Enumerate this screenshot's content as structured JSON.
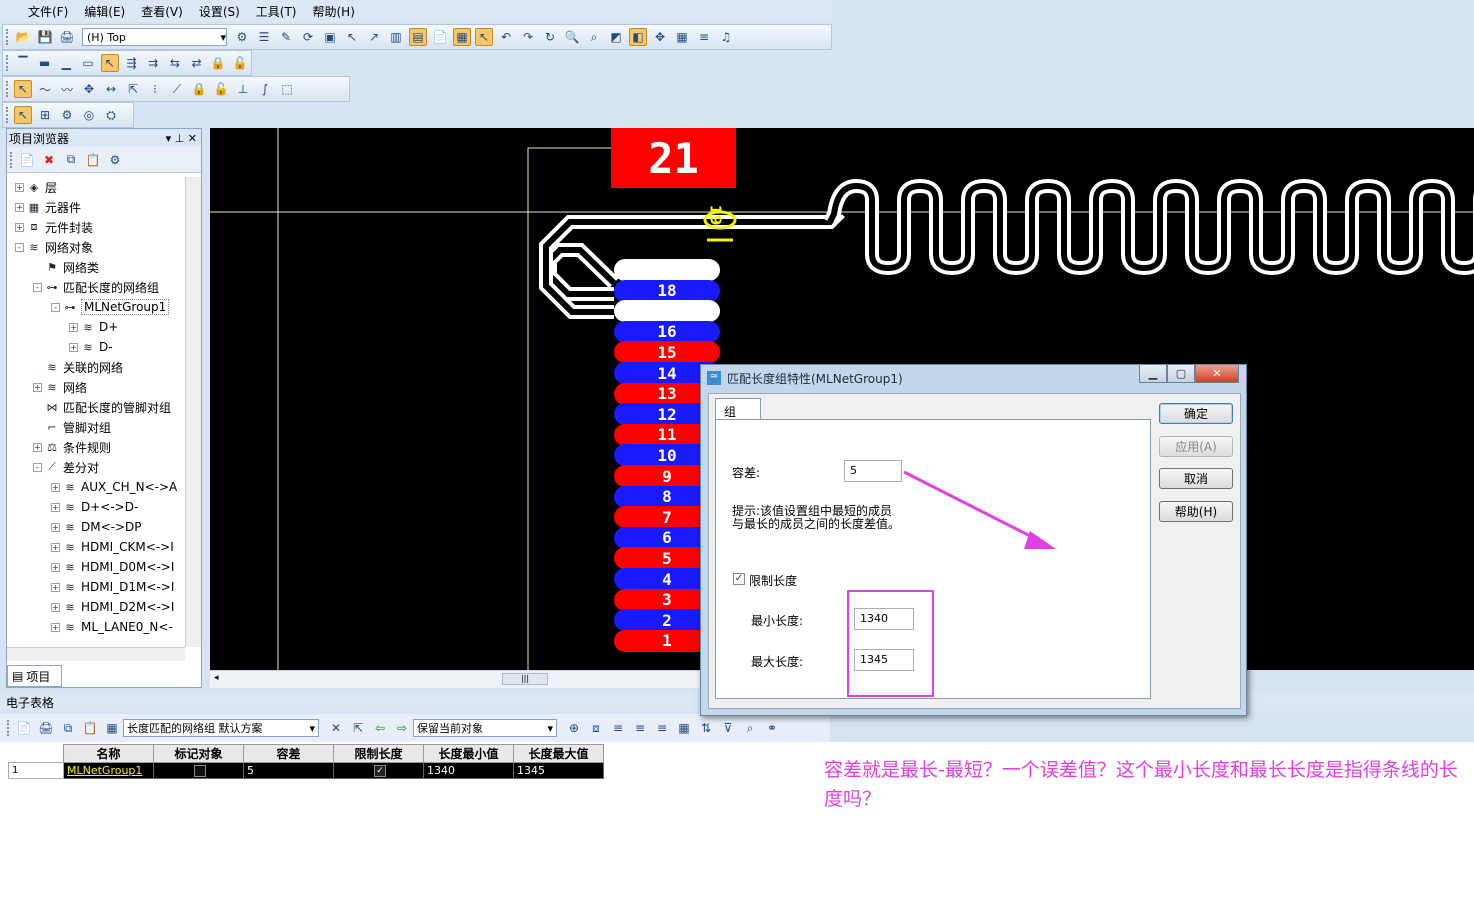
{
  "menu": [
    "文件(F)",
    "编辑(E)",
    "查看(V)",
    "设置(S)",
    "工具(T)",
    "帮助(H)"
  ],
  "toolbar": {
    "layer_value": "(H) Top"
  },
  "project_browser": {
    "title": "项目浏览器",
    "tab_label": "项目",
    "tree": [
      {
        "label": "层",
        "level": 0,
        "exp": "+",
        "icon": "layers-icon"
      },
      {
        "label": "元器件",
        "level": 0,
        "exp": "+",
        "icon": "component-icon"
      },
      {
        "label": "元件封装",
        "level": 0,
        "exp": "+",
        "icon": "footprint-icon"
      },
      {
        "label": "网络对象",
        "level": 0,
        "exp": "-",
        "icon": "net-objects-icon"
      },
      {
        "label": "网络类",
        "level": 1,
        "exp": "",
        "icon": "net-class-icon"
      },
      {
        "label": "匹配长度的网络组",
        "level": 1,
        "exp": "-",
        "icon": "matched-group-icon"
      },
      {
        "label": "MLNetGroup1",
        "level": 2,
        "exp": "-",
        "icon": "matched-group-icon"
      },
      {
        "label": "D+",
        "level": 3,
        "exp": "+",
        "icon": "net-icon"
      },
      {
        "label": "D-",
        "level": 3,
        "exp": "+",
        "icon": "net-icon"
      },
      {
        "label": "关联的网络",
        "level": 1,
        "exp": "",
        "icon": "net-icon"
      },
      {
        "label": "网络",
        "level": 1,
        "exp": "+",
        "icon": "net-icon"
      },
      {
        "label": "匹配长度的管脚对组",
        "level": 1,
        "exp": "",
        "icon": "pinpair-group-icon"
      },
      {
        "label": "管脚对组",
        "level": 1,
        "exp": "",
        "icon": "pinpair-icon"
      },
      {
        "label": "条件规则",
        "level": 1,
        "exp": "+",
        "icon": "rules-icon"
      },
      {
        "label": "差分对",
        "level": 1,
        "exp": "-",
        "icon": "diffpair-icon"
      },
      {
        "label": "AUX_CH_N<->A",
        "level": 2,
        "exp": "+",
        "icon": "net-icon"
      },
      {
        "label": "D+<->D-",
        "level": 2,
        "exp": "+",
        "icon": "net-icon"
      },
      {
        "label": "DM<->DP",
        "level": 2,
        "exp": "+",
        "icon": "net-icon"
      },
      {
        "label": "HDMI_CKM<->I",
        "level": 2,
        "exp": "+",
        "icon": "net-icon"
      },
      {
        "label": "HDMI_D0M<->I",
        "level": 2,
        "exp": "+",
        "icon": "net-icon"
      },
      {
        "label": "HDMI_D1M<->I",
        "level": 2,
        "exp": "+",
        "icon": "net-icon"
      },
      {
        "label": "HDMI_D2M<->I",
        "level": 2,
        "exp": "+",
        "icon": "net-icon"
      },
      {
        "label": "ML_LANE0_N<-",
        "level": 2,
        "exp": "+",
        "icon": "net-icon"
      }
    ]
  },
  "canvas": {
    "ref_label": "21",
    "pin_marker": "19",
    "pads": [
      {
        "n": "",
        "c": "#ffffff"
      },
      {
        "n": "18",
        "c": "#1a1aff"
      },
      {
        "n": "",
        "c": "#ffffff"
      },
      {
        "n": "16",
        "c": "#1a1aff"
      },
      {
        "n": "15",
        "c": "#ff0000"
      },
      {
        "n": "14",
        "c": "#1a1aff"
      },
      {
        "n": "13",
        "c": "#ff0000"
      },
      {
        "n": "12",
        "c": "#1a1aff"
      },
      {
        "n": "11",
        "c": "#ff0000"
      },
      {
        "n": "10",
        "c": "#1a1aff"
      },
      {
        "n": "9",
        "c": "#ff0000"
      },
      {
        "n": "8",
        "c": "#1a1aff"
      },
      {
        "n": "7",
        "c": "#ff0000"
      },
      {
        "n": "6",
        "c": "#1a1aff"
      },
      {
        "n": "5",
        "c": "#ff0000"
      },
      {
        "n": "4",
        "c": "#1a1aff"
      },
      {
        "n": "3",
        "c": "#ff0000"
      },
      {
        "n": "2",
        "c": "#1a1aff"
      },
      {
        "n": "1",
        "c": "#ff0000"
      }
    ]
  },
  "dialog": {
    "title": "匹配长度组特性(MLNetGroup1)",
    "tab": "组",
    "tolerance_label": "容差:",
    "tolerance_value": "5",
    "hint_line1": "提示:该值设置组中最短的成员",
    "hint_line2": "与最长的成员之间的长度差值。",
    "limit_label": "限制长度",
    "limit_checked": true,
    "min_label": "最小长度:",
    "min_value": "1340",
    "max_label": "最大长度:",
    "max_value": "1345",
    "buttons": {
      "ok": "确定",
      "apply": "应用(A)",
      "cancel": "取消",
      "help": "帮助(H)"
    }
  },
  "spreadsheet": {
    "title": "电子表格",
    "scheme": "长度匹配的网络组 默认方案",
    "filter": "保留当前对象",
    "headers": [
      "名称",
      "标记对象",
      "容差",
      "限制长度",
      "长度最小值",
      "长度最大值"
    ],
    "row": {
      "index": "1",
      "name": "MLNetGroup1",
      "tolerance": "5",
      "min": "1340",
      "max": "1345"
    }
  },
  "annotation": "容差就是最长-最短？一个误差值？这个最小长度和最长长度是指得条线的长度吗？",
  "colors": {
    "annotation": "#e040e0",
    "pad_red": "#ff0000",
    "pad_blue": "#1a1aff",
    "highlight_box": "#e040e0"
  }
}
